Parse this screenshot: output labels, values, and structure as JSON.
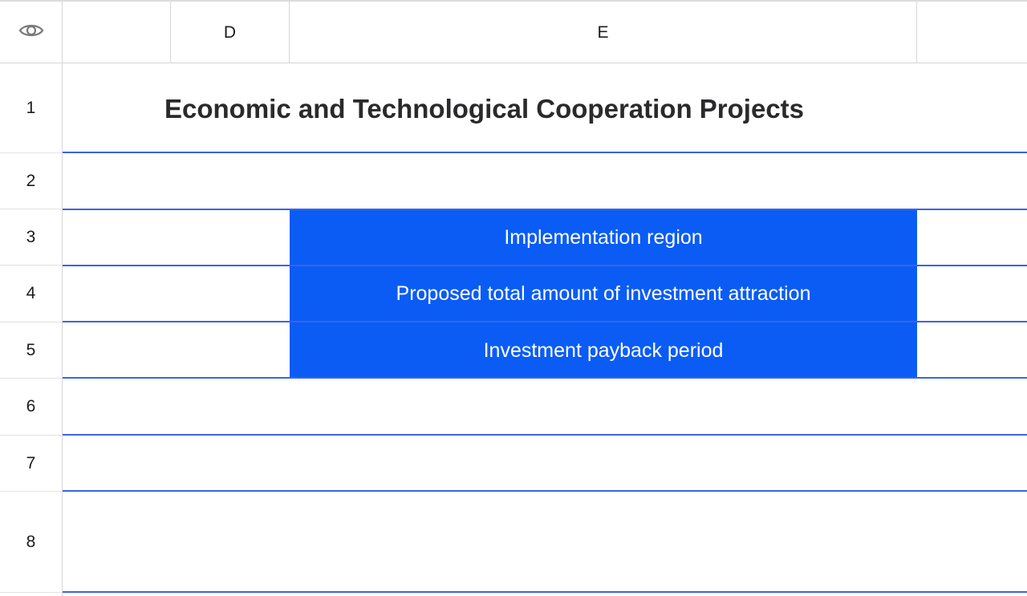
{
  "header": {
    "visibility_icon": "eye-icon",
    "columns": [
      "",
      "D",
      "E",
      ""
    ]
  },
  "rows": {
    "numbers": [
      "1",
      "2",
      "3",
      "4",
      "5",
      "6",
      "7",
      "8"
    ]
  },
  "cells": {
    "title": "Economic and Technological Cooperation Projects",
    "E3": "Implementation region",
    "E4": "Proposed total amount of investment attraction",
    "E5": "Investment payback period"
  },
  "colors": {
    "selection_fill": "#0a5cf5",
    "grid_line": "#3d63e6"
  }
}
